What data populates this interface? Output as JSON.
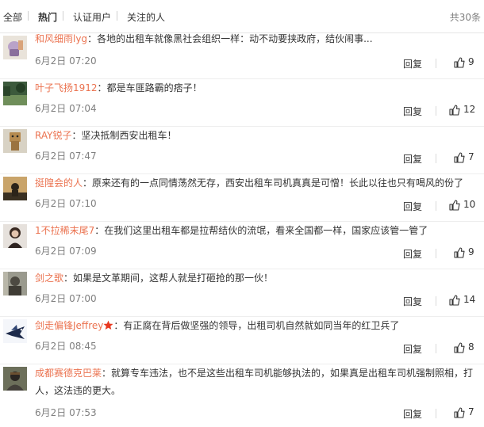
{
  "tabs": [
    "全部",
    "热门",
    "认证用户",
    "关注的人"
  ],
  "active_tab": "热门",
  "total": "共30条",
  "reply_label": "回复",
  "colors": {
    "username": "#eb7350",
    "vip_star": "#e8381f"
  },
  "comments": [
    {
      "user": "和风细雨lyg",
      "sep": "：",
      "text": "各地的出租车就像黑社会组织一样：动不动要挟政府，结伙闹事...",
      "time": "6月2日 07:20",
      "likes": "9"
    },
    {
      "user": "叶子飞扬1912",
      "sep": "：",
      "text": "都是车匪路霸的痞子！",
      "time": "6月2日 07:04",
      "likes": "12"
    },
    {
      "user": "RAY锐子",
      "sep": "：",
      "text": "坚决抵制西安出租车！",
      "time": "6月2日 07:47",
      "likes": "7"
    },
    {
      "user": "挺隍会的人",
      "sep": "：",
      "text": "原来还有的一点同情荡然无存，西安出租车司机真真是可憎！长此以往也只有喝风的份了",
      "time": "6月2日 07:10",
      "likes": "10"
    },
    {
      "user": "1不拉稀末尾7",
      "sep": "：",
      "text": "在我们这里出租车都是拉帮结伙的流氓，看来全国都一样，国家应该管一管了",
      "time": "6月2日 07:09",
      "likes": "9"
    },
    {
      "user": "剑之歌",
      "sep": "：",
      "text": "如果是文革期间，这帮人就是打砸抢的那一伙！",
      "time": "6月2日 07:00",
      "likes": "14"
    },
    {
      "user": "剑走偏锋Jeffrey",
      "sep": "：",
      "text": "有正腐在背后做坚强的领导，出租司机自然就如同当年的红卫兵了",
      "time": "6月2日 08:45",
      "likes": "8",
      "vip": "vip-star-icon"
    },
    {
      "user": "成都赛德克巴莱",
      "sep": "：",
      "text": "就算专车违法，也不是这些出租车司机能够执法的，如果真是出租车司机强制照相，打人，这法违的更大。",
      "time": "6月2日 07:53",
      "likes": "7"
    }
  ]
}
